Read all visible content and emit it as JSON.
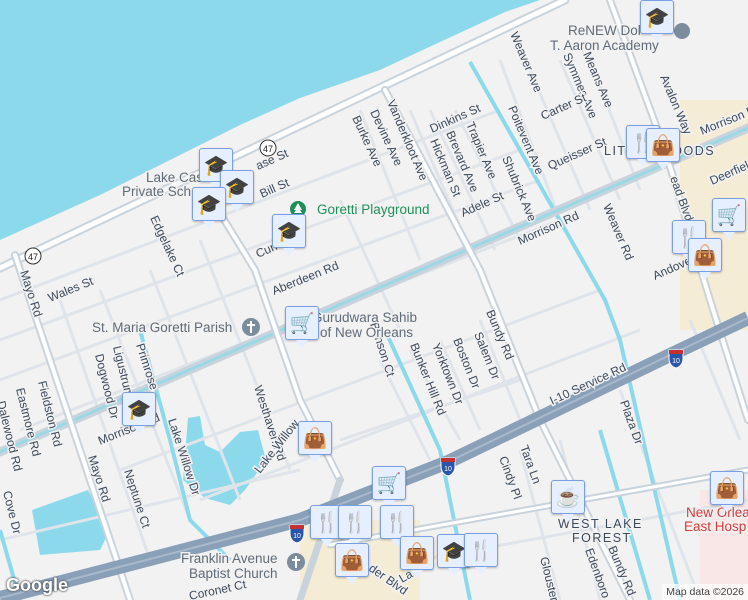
{
  "map": {
    "roads": {
      "morrison_1": "Morrison Rd",
      "morrison_2": "Morrison Rd",
      "morrison_3": "Morrison Rd",
      "i10_service": "I-10 Service Rd",
      "bundy_1": "Bundy Rd",
      "bundy_2": "Bundy Rd",
      "mayo_1": "Mayo Rd",
      "mayo_2": "Mayo Rd",
      "vanderkloot": "Vanderkloot Ave",
      "aberdeen": "Aberdeen Rd",
      "wales": "Wales St",
      "edgelake": "Edgelake Ct",
      "westhaven": "Westhaven Rd",
      "lake_willow_dr": "Lake Willow Dr",
      "lake_willow": "Lake Willow",
      "neptune": "Neptune Ct",
      "dogwood": "Dogwood Dr",
      "ligustrum": "Ligustrum",
      "primrose": "Primrose",
      "fieldston": "Fieldston Rd",
      "eastmore": "Eastmore Rd",
      "dalewood": "Dalewood Rd",
      "cove": "Cove Dr",
      "benson": "Benson Ct",
      "bunker_hill": "Bunker Hill Rd",
      "yorktown": "Yorktown Dr",
      "boston": "Boston Dr",
      "salem": "Salem Dr",
      "burke": "Burke Ave",
      "devine": "Devine Ave",
      "dinkins": "Dinkins St",
      "hickman": "Hickman St",
      "brevard": "Brevard Ave",
      "trapier": "Trapier Ave",
      "adele": "Adele St",
      "shubrick": "Shubrick Ave",
      "poitevent": "Poitevent Ave",
      "weaver_ave": "Weaver Ave",
      "symmes": "Symmes Ave",
      "means": "Means Ave",
      "carter": "Carter St",
      "queisser": "Queisser St",
      "avalon": "Avalon Way",
      "weaver_rd": "Weaver Rd",
      "andover": "Andove",
      "deerfield": "Deerfield",
      "read_blvd": "ead Blvd",
      "plaza": "Plaza Dr",
      "tara": "Tara Ln",
      "cindy": "Cindy Pl",
      "edenboro": "Edenboro Rd",
      "glouster": "Glouster",
      "bill": "Bill St",
      "chase": "ase St",
      "cun": "Cun",
      "coronet": "Coronet Ct",
      "crowder": "der Blvd",
      "lake_short": "La"
    },
    "shields": {
      "la47_a": "47",
      "la47_b": "47",
      "i10_a": "10",
      "i10_b": "10",
      "i10_c": "10"
    },
    "pois": {
      "lake_castle_1": "Lake Cast",
      "lake_castle_2": "Private Sch",
      "goretti_playground": "Goretti Playground",
      "st_maria": "St. Maria Goretti Parish",
      "gurudwara_1": "Gurudwara Sahib",
      "gurudwara_2": "of New Orleans",
      "renew_1": "ReNEW Dol",
      "renew_2": "T. Aaron Academy",
      "franklin_1": "Franklin Avenue",
      "franklin_2": "Baptist Church",
      "hospital_1": "New Orlea",
      "hospital_2": "East Hosp"
    },
    "areas": {
      "little_woods": "LITTLE WOODS",
      "west_lake_forest_1": "WEST LAKE",
      "west_lake_forest_2": "FOREST"
    },
    "logo": "Google",
    "attribution": "Map data ©2026"
  },
  "colors": {
    "water": "#8dd9ec",
    "road": "#ffffff",
    "road_casing": "#c9d3dc",
    "highway": "#8a9fb8",
    "marker_bg": "#e6efff",
    "marker_icon": "#0d4a6e"
  }
}
